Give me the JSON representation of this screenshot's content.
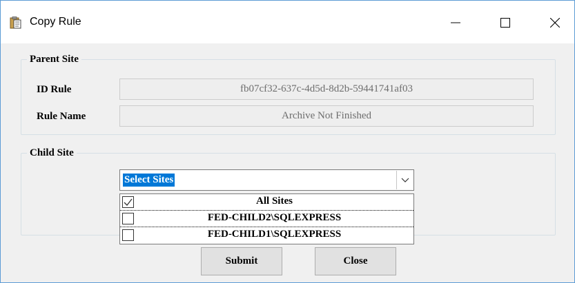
{
  "window": {
    "title": "Copy Rule",
    "icon": "clipboard-icon"
  },
  "parent_site": {
    "legend": "Parent Site",
    "id_rule_label": "ID Rule",
    "id_rule_value": "fb07cf32-637c-4d5d-8d2b-59441741af03",
    "rule_name_label": "Rule Name",
    "rule_name_value": "Archive Not Finished"
  },
  "child_site": {
    "legend": "Child Site",
    "select_value": "Select Sites",
    "options": [
      {
        "label": "All Sites",
        "checked": true
      },
      {
        "label": "FED-CHILD2\\SQLEXPRESS",
        "checked": false
      },
      {
        "label": "FED-CHILD1\\SQLEXPRESS",
        "checked": false
      }
    ]
  },
  "buttons": {
    "submit": "Submit",
    "close": "Close"
  },
  "colors": {
    "accent": "#0078d7",
    "window_border": "#5b9bd5"
  }
}
